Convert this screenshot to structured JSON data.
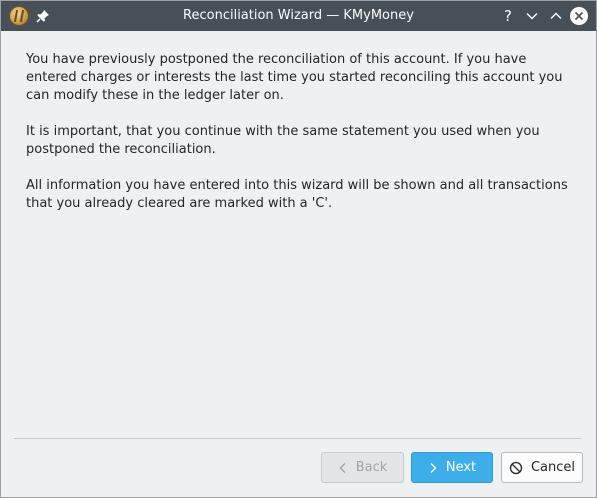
{
  "window": {
    "title": "Reconciliation Wizard — KMyMoney",
    "help_glyph": "?"
  },
  "content": {
    "paragraphs": [
      "You have previously postponed the reconciliation of this account. If you have entered charges or interests the last time you started reconciling this account you can modify these in the ledger later on.",
      "It is important, that you continue with the same statement you used when you postponed the reconciliation.",
      "All information you have entered into this wizard will be shown and all transactions that you already cleared are marked with a 'C'."
    ]
  },
  "buttons": {
    "back": {
      "label": "Back",
      "enabled": false,
      "icon": "chevron-left-icon"
    },
    "next": {
      "label": "Next",
      "enabled": true,
      "icon": "chevron-right-icon"
    },
    "cancel": {
      "label": "Cancel",
      "enabled": true,
      "icon": "cancel-icon"
    }
  },
  "colors": {
    "titlebar": "#475057",
    "window_bg": "#eff0f1",
    "accent": "#3daee9",
    "text": "#232627"
  }
}
